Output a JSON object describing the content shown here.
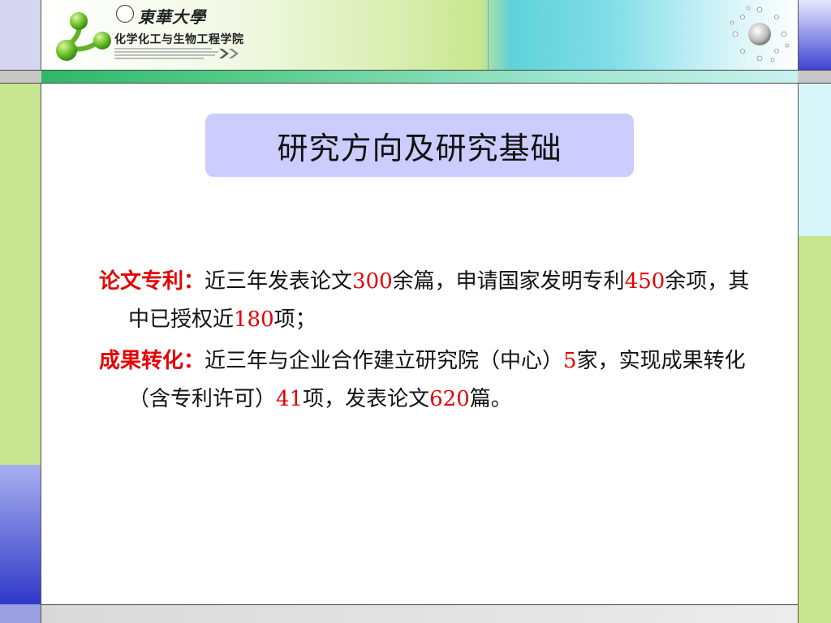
{
  "header": {
    "school_name": "東華大學",
    "college_name": "化学化工与生物工程学院"
  },
  "slide": {
    "title": "研究方向及研究基础"
  },
  "content": {
    "paragraphs": [
      {
        "label": "论文专利：",
        "segments": [
          {
            "text": "近三年发表论文",
            "highlight": false
          },
          {
            "text": "300",
            "highlight": true
          },
          {
            "text": "余篇，申请国家发明专利",
            "highlight": false
          },
          {
            "text": "450",
            "highlight": true
          },
          {
            "text": "余项，其中已授权近",
            "highlight": false
          },
          {
            "text": "180",
            "highlight": true
          },
          {
            "text": "项；",
            "highlight": false
          }
        ]
      },
      {
        "label": "成果转化：",
        "segments": [
          {
            "text": "近三年与企业合作建立研究院（中心）",
            "highlight": false
          },
          {
            "text": "5",
            "highlight": true
          },
          {
            "text": "家，实现成果转化（含专利许可）",
            "highlight": false
          },
          {
            "text": "41",
            "highlight": true
          },
          {
            "text": "项，发表论文",
            "highlight": false
          },
          {
            "text": "620",
            "highlight": true
          },
          {
            "text": "篇。",
            "highlight": false
          }
        ]
      }
    ]
  },
  "colors": {
    "label_red": "#e60000",
    "title_box": "#ccccff",
    "accent_green": "#c9e58f",
    "accent_blue": "#3038c8"
  }
}
